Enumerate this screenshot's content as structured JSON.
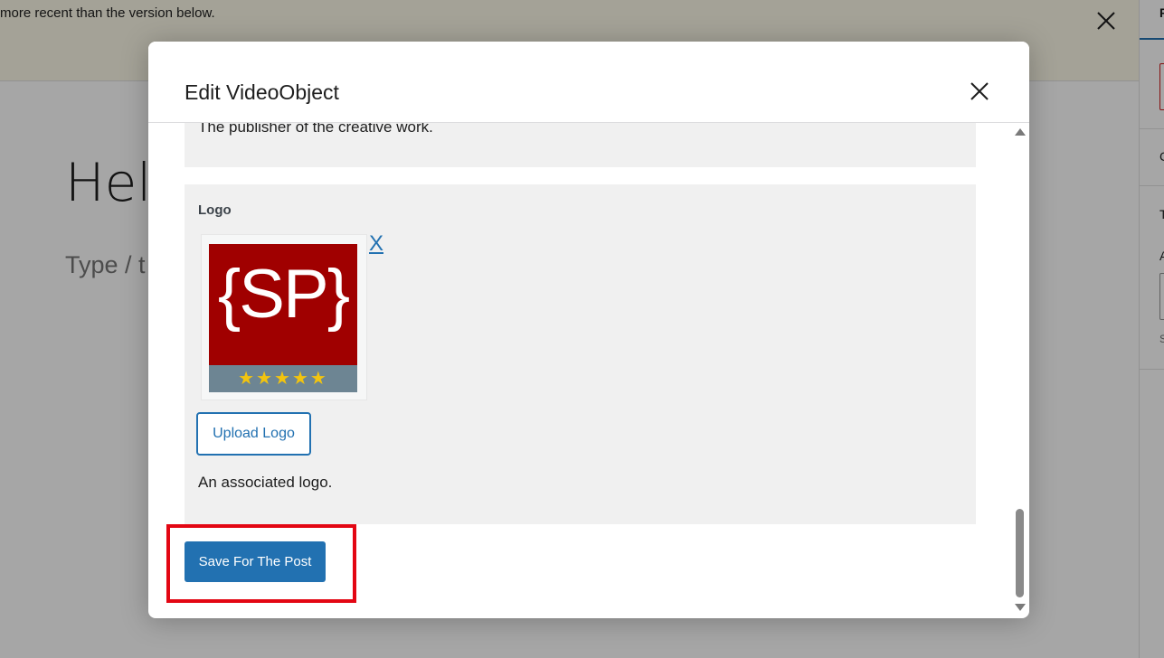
{
  "background": {
    "notice_text": "more recent than the version below.",
    "editor_title": "Hel",
    "editor_placeholder": "Type / t",
    "sidebar": {
      "tab_letter": "P",
      "letters": [
        "C",
        "T",
        "A",
        "S"
      ]
    }
  },
  "modal": {
    "title": "Edit VideoObject",
    "publisher_description": "The publisher of the creative work.",
    "logo": {
      "label": "Logo",
      "image_text": "{SP}",
      "image_stars": "★★★★★",
      "remove_label": "X",
      "upload_button": "Upload Logo",
      "description": "An associated logo."
    },
    "save_button": "Save For The Post"
  },
  "colors": {
    "accent": "#2271b1",
    "highlight": "#e30613",
    "logo_bg": "#a00000",
    "logo_star_bar": "#6d8593",
    "star": "#f2c40f"
  }
}
